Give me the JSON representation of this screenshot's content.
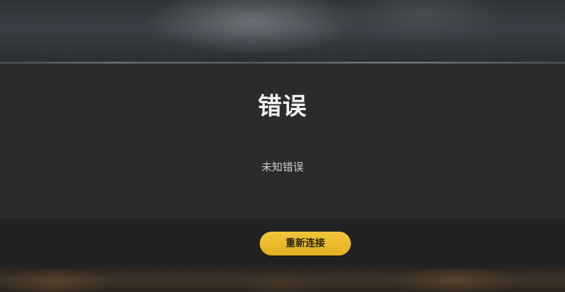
{
  "dialog": {
    "title": "错误",
    "message": "未知错误",
    "button_label": "重新连接"
  },
  "colors": {
    "panel": "#2b2b2b",
    "footer": "#222222",
    "button": "#e8b928",
    "title_text": "#f2f2f2"
  }
}
